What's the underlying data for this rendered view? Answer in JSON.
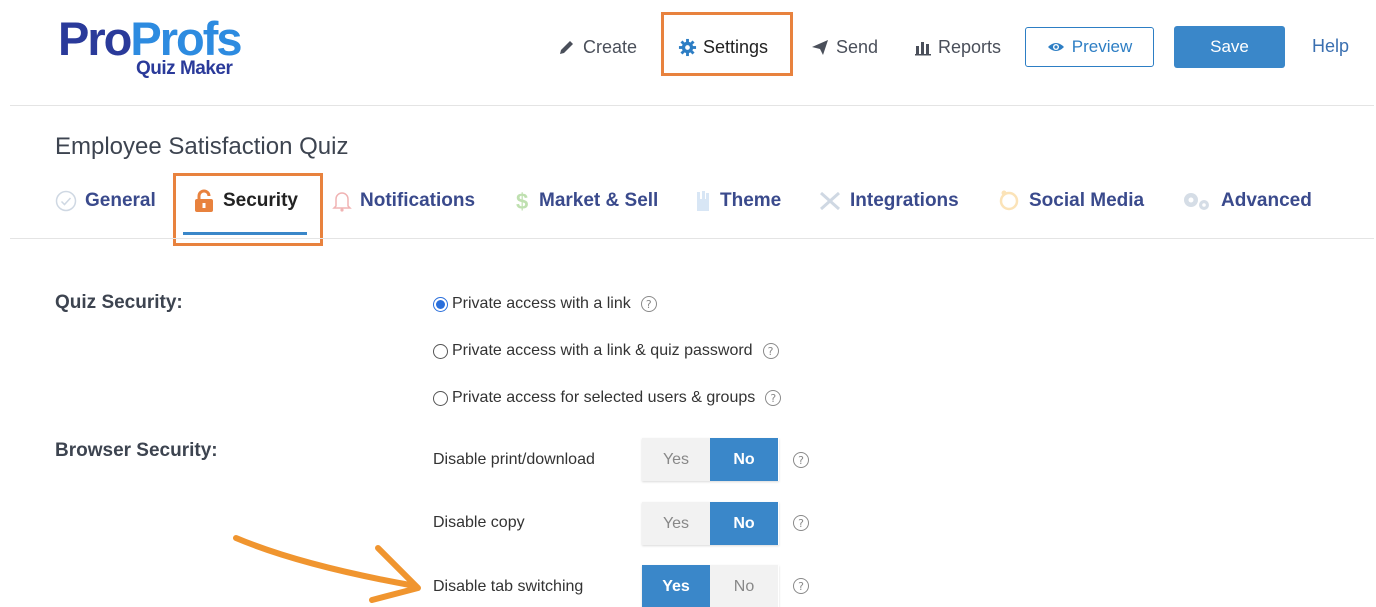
{
  "logo": {
    "part1": "Pro",
    "part2": "Profs",
    "sub": "Quiz Maker"
  },
  "nav": {
    "create": "Create",
    "settings": "Settings",
    "send": "Send",
    "reports": "Reports",
    "preview": "Preview",
    "save": "Save",
    "help": "Help"
  },
  "quiz_title": "Employee Satisfaction Quiz",
  "tabs": [
    {
      "label": "General",
      "icon": "check-circle-icon"
    },
    {
      "label": "Security",
      "icon": "lock-icon",
      "active": true
    },
    {
      "label": "Notifications",
      "icon": "bell-icon"
    },
    {
      "label": "Market & Sell",
      "icon": "dollar-icon"
    },
    {
      "label": "Theme",
      "icon": "theme-icon"
    },
    {
      "label": "Integrations",
      "icon": "tools-icon"
    },
    {
      "label": "Social Media",
      "icon": "social-icon"
    },
    {
      "label": "Advanced",
      "icon": "gears-icon"
    }
  ],
  "quiz_security": {
    "label": "Quiz Security:",
    "options": [
      {
        "label": "Private access with a link",
        "selected": true
      },
      {
        "label": "Private access with a link & quiz password",
        "selected": false
      },
      {
        "label": "Private access for selected users & groups",
        "selected": false
      }
    ]
  },
  "browser_security": {
    "label": "Browser Security:",
    "yes": "Yes",
    "no": "No",
    "settings": [
      {
        "label": "Disable print/download",
        "value": "No"
      },
      {
        "label": "Disable copy",
        "value": "No"
      },
      {
        "label": "Disable tab switching",
        "value": "Yes"
      }
    ]
  },
  "help_glyph": "?",
  "colors": {
    "accent": "#3a87c9",
    "highlight": "#e8823e",
    "brand_dark": "#2a3a9a",
    "brand_light": "#2d8be0"
  }
}
